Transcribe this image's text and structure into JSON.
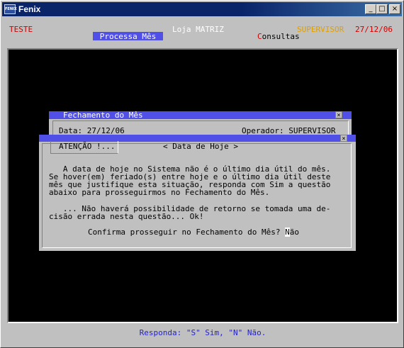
{
  "window": {
    "title": "Fenix",
    "icon_text": "FENIX"
  },
  "header": {
    "left": "TESTE",
    "store": "Loja MATRIZ",
    "user": "SUPERVISOR",
    "date": "27/12/06",
    "menu_active": "Processa Mês",
    "menu_consultas_first": "C",
    "menu_consultas_rest": "onsultas"
  },
  "dialog1": {
    "title": "Fechamento do Mês",
    "date_label": "Data: 27/12/06",
    "operator_label": "Operador: SUPERVISOR"
  },
  "dialog2": {
    "tab": "ATENÇÃO !...",
    "subtitle": "< Data de Hoje >",
    "lines": [
      "   A data de hoje no Sistema não é o último dia útil do mês.",
      "Se hover(em) feriado(s) entre hoje e o último dia útil deste",
      "mês que justifique esta situação, responda com Sim a questão",
      "abaixo para prosseguirmos no Fechamento do Mês.",
      "",
      "   ... Não haverá possibilidade de retorno se tomada uma de-",
      "cisão errada nesta questão... Ok!"
    ],
    "question": "Confirma prosseguir no Fechamento do Mês? ",
    "answer_first": "N",
    "answer_rest": "ão"
  },
  "status": "Responda: \"S\" Sim, \"N\" Não.",
  "colors": {
    "title_red": "#d00000",
    "user_orange": "#e0a000",
    "menu_blue": "#5050e8",
    "status_blue": "#2323c8"
  }
}
